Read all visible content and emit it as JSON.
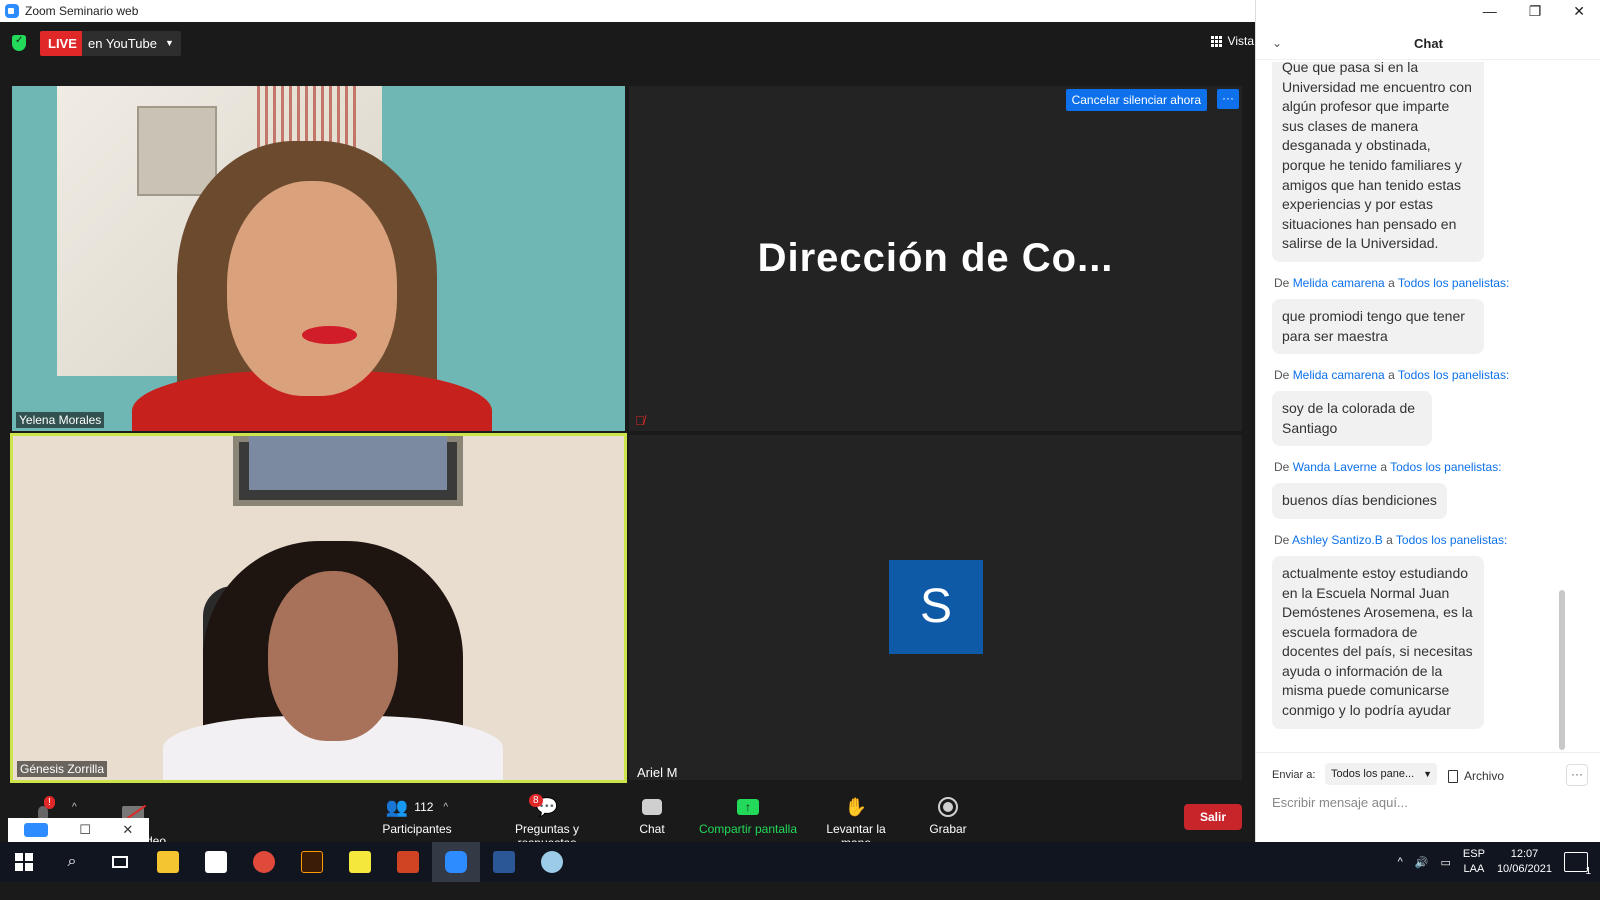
{
  "window": {
    "title": "Zoom Seminario web",
    "min": "—",
    "max": "❐",
    "close": "✕"
  },
  "topbar": {
    "live": "LIVE",
    "live_target": "en YouTube",
    "view": "Vista"
  },
  "tiles": {
    "t1_name": "Yelena Morales",
    "t2_name": "Dirección de Co...",
    "t2_cancel": "Cancelar silenciar ahora",
    "t2_more": "···",
    "t3_name": "Génesis Zorrilla",
    "t4_name": "Ariel M",
    "t4_initial": "S"
  },
  "toolbar": {
    "participants_count": "112",
    "participants": "Participantes",
    "qa_badge": "8",
    "qa": "Preguntas y respuestas",
    "chat": "Chat",
    "share": "Compartir pantalla",
    "raise": "Levantar la mano",
    "record": "Grabar",
    "leave": "Salir",
    "video_partial": "deo",
    "mic_badge": "!"
  },
  "chat": {
    "title": "Chat",
    "messages": [
      {
        "from": "",
        "to": "",
        "text": "Que que pasa si en la Universidad me encuentro con algún  profesor que imparte sus clases de manera desganada y obstinada, porque he tenido familiares y amigos que han tenido estas experiencias y por estas situaciones han pensado en salirse de la Universidad."
      },
      {
        "from": "Melida camarena",
        "to": "Todos los panelistas:",
        "text": "que promiodi tengo que tener para ser maestra"
      },
      {
        "from": "Melida camarena",
        "to": "Todos los panelistas:",
        "text": "soy de la colorada de Santiago"
      },
      {
        "from": "Wanda Laverne",
        "to": "Todos los panelistas:",
        "text": "buenos días bendiciones"
      },
      {
        "from": "Ashley Santizo.B",
        "to": "Todos los panelistas:",
        "text": "actualmente estoy estudiando en la Escuela Normal Juan Demóstenes Arosemena, es la escuela formadora de docentes del país, si necesitas ayuda o información de la misma puede comunicarse conmigo y lo podría ayudar"
      }
    ],
    "de": "De",
    "a": "a",
    "send_to_label": "Enviar a:",
    "send_to_value": "Todos los pane...",
    "file": "Archivo",
    "more": "···",
    "placeholder": "Escribir mensaje aquí..."
  },
  "taskbar": {
    "lang1": "ESP",
    "lang2": "LAA",
    "time": "12:07",
    "date": "10/06/2021",
    "notif": "1"
  }
}
